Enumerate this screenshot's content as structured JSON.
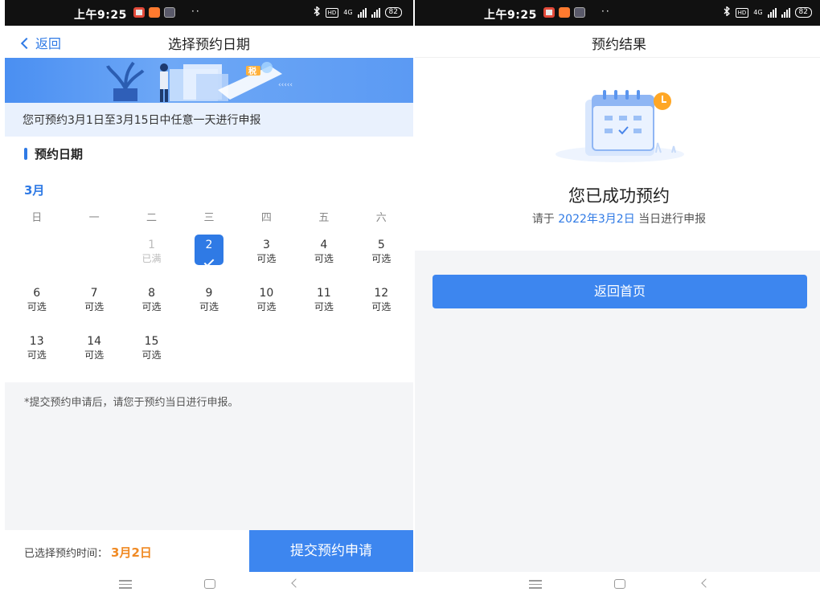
{
  "left": {
    "status": {
      "time": "上午9:25",
      "dots": "··",
      "hd": "HD",
      "net": "4G",
      "battery": "82"
    },
    "nav": {
      "back_label": "返回",
      "title": "选择预约日期"
    },
    "banner": {
      "tax_badge": "税"
    },
    "notice": "您可预约3月1日至3月15日中任意一天进行申报",
    "section_title": "预约日期",
    "calendar": {
      "month": "3月",
      "weekdays": [
        "日",
        "一",
        "二",
        "三",
        "四",
        "五",
        "六"
      ],
      "days": [
        {
          "num": "1",
          "status": "已满",
          "state": "full"
        },
        {
          "num": "2",
          "status": "",
          "state": "selected"
        },
        {
          "num": "3",
          "status": "可选",
          "state": "available"
        },
        {
          "num": "4",
          "status": "可选",
          "state": "available"
        },
        {
          "num": "5",
          "status": "可选",
          "state": "available"
        },
        {
          "num": "6",
          "status": "可选",
          "state": "available"
        },
        {
          "num": "7",
          "status": "可选",
          "state": "available"
        },
        {
          "num": "8",
          "status": "可选",
          "state": "available"
        },
        {
          "num": "9",
          "status": "可选",
          "state": "available"
        },
        {
          "num": "10",
          "status": "可选",
          "state": "available"
        },
        {
          "num": "11",
          "status": "可选",
          "state": "available"
        },
        {
          "num": "12",
          "status": "可选",
          "state": "available"
        },
        {
          "num": "13",
          "status": "可选",
          "state": "available"
        },
        {
          "num": "14",
          "status": "可选",
          "state": "available"
        },
        {
          "num": "15",
          "status": "可选",
          "state": "available"
        }
      ]
    },
    "tip": "*提交预约申请后，请您于预约当日进行申报。",
    "bottom": {
      "selected_label": "已选择预约时间：",
      "selected_value": "3月2日",
      "submit_label": "提交预约申请"
    }
  },
  "right": {
    "status": {
      "time": "上午9:25",
      "dots": "··",
      "hd": "HD",
      "net": "4G",
      "battery": "82"
    },
    "nav": {
      "title": "预约结果"
    },
    "success_title": "您已成功预约",
    "success_sub_prefix": "请于 ",
    "success_sub_date": "2022年3月2日",
    "success_sub_suffix": " 当日进行申报",
    "home_button_label": "返回首页"
  },
  "colors": {
    "accent": "#2f7ae5",
    "button": "#3d86ef",
    "highlight": "#f08a24",
    "disabled": "#bbbbbb"
  },
  "icons": [
    "back-chevron-icon",
    "check-icon",
    "calendar-clock-icon",
    "bluetooth-icon",
    "signal-icon",
    "battery-icon",
    "menu-icon",
    "home-icon",
    "back-icon"
  ]
}
